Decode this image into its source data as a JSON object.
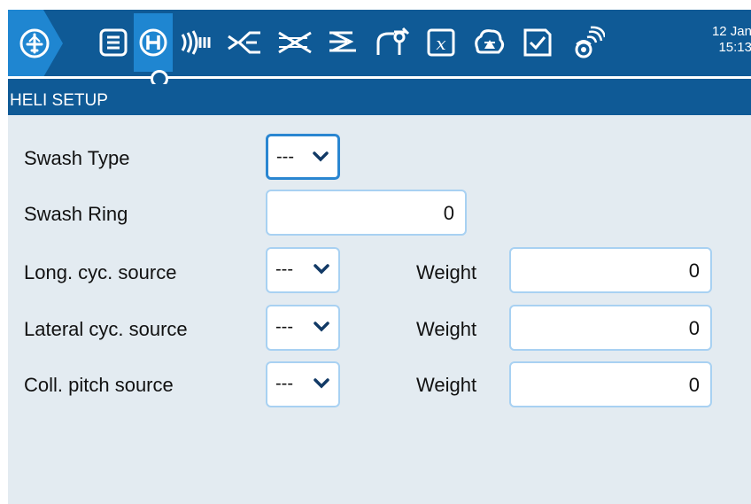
{
  "header": {
    "date": "12 Jan",
    "time": "15:13",
    "tabs": [
      {
        "name": "home-icon"
      },
      {
        "name": "model-list-icon"
      },
      {
        "name": "heli-icon",
        "active": true
      },
      {
        "name": "flight-modes-icon"
      },
      {
        "name": "inputs-icon"
      },
      {
        "name": "mixes-icon"
      },
      {
        "name": "outputs-icon"
      },
      {
        "name": "curves-icon"
      },
      {
        "name": "global-variables-icon"
      },
      {
        "name": "logical-switches-icon"
      },
      {
        "name": "special-functions-icon"
      },
      {
        "name": "checklist-icon"
      },
      {
        "name": "telemetry-icon"
      }
    ]
  },
  "page": {
    "title": "HELI SETUP"
  },
  "form": {
    "swash_type": {
      "label": "Swash Type",
      "value": "---"
    },
    "swash_ring": {
      "label": "Swash Ring",
      "value": "0"
    },
    "long_cyc": {
      "label": "Long. cyc. source",
      "value": "---",
      "weight_label": "Weight",
      "weight": "0"
    },
    "lateral_cyc": {
      "label": "Lateral cyc. source",
      "value": "---",
      "weight_label": "Weight",
      "weight": "0"
    },
    "coll_pitch": {
      "label": "Coll. pitch source",
      "value": "---",
      "weight_label": "Weight",
      "weight": "0"
    }
  },
  "colors": {
    "header_bg": "#0f5a96",
    "active_tab": "#1f86d1",
    "body_bg": "#e3ebf1",
    "field_border": "#a8d1f2",
    "focus_border": "#2a86d1"
  }
}
